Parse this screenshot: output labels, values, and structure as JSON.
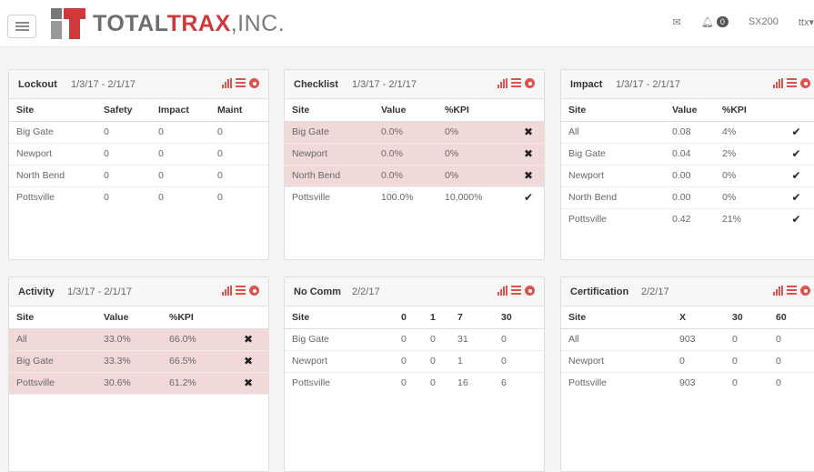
{
  "header": {
    "logo_main": "TOTAL",
    "logo_accent": "TRAX",
    "logo_inc": ",INC.",
    "notification_count": "0",
    "device": "SX200",
    "user": "ttx▾"
  },
  "colors": {
    "accent": "#d9534f",
    "bad_row": "#f1d9d9"
  },
  "panels": {
    "lockout": {
      "title": "Lockout",
      "range": "1/3/17 - 2/1/17",
      "headers": [
        "Site",
        "Safety",
        "Impact",
        "Maint"
      ],
      "rows": [
        [
          "Big Gate",
          "0",
          "0",
          "0"
        ],
        [
          "Newport",
          "0",
          "0",
          "0"
        ],
        [
          "North Bend",
          "0",
          "0",
          "0"
        ],
        [
          "Pottsville",
          "0",
          "0",
          "0"
        ]
      ]
    },
    "checklist": {
      "title": "Checklist",
      "range": "1/3/17 - 2/1/17",
      "headers": [
        "Site",
        "Value",
        "%KPI",
        ""
      ],
      "rows": [
        [
          "Big Gate",
          "0.0%",
          "0%",
          "✖"
        ],
        [
          "Newport",
          "0.0%",
          "0%",
          "✖"
        ],
        [
          "North Bend",
          "0.0%",
          "0%",
          "✖"
        ],
        [
          "Pottsville",
          "100.0%",
          "10,000%",
          "✔"
        ]
      ]
    },
    "impact": {
      "title": "Impact",
      "range": "1/3/17 - 2/1/17",
      "headers": [
        "Site",
        "Value",
        "%KPI",
        ""
      ],
      "rows": [
        [
          "All",
          "0.08",
          "4%",
          "✔"
        ],
        [
          "Big Gate",
          "0.04",
          "2%",
          "✔"
        ],
        [
          "Newport",
          "0.00",
          "0%",
          "✔"
        ],
        [
          "North Bend",
          "0.00",
          "0%",
          "✔"
        ],
        [
          "Pottsville",
          "0.42",
          "21%",
          "✔"
        ]
      ]
    },
    "activity": {
      "title": "Activity",
      "range": "1/3/17 - 2/1/17",
      "headers": [
        "Site",
        "Value",
        "%KPI",
        ""
      ],
      "rows": [
        [
          "All",
          "33.0%",
          "66.0%",
          "✖"
        ],
        [
          "Big Gate",
          "33.3%",
          "66.5%",
          "✖"
        ],
        [
          "Pottsville",
          "30.6%",
          "61.2%",
          "✖"
        ]
      ]
    },
    "nocomm": {
      "title": "No Comm",
      "range": "2/2/17",
      "headers": [
        "Site",
        "0",
        "1",
        "7",
        "30"
      ],
      "rows": [
        [
          "Big Gate",
          "0",
          "0",
          "31",
          "0"
        ],
        [
          "Newport",
          "0",
          "0",
          "1",
          "0"
        ],
        [
          "Pottsville",
          "0",
          "0",
          "16",
          "6"
        ]
      ]
    },
    "certification": {
      "title": "Certification",
      "range": "2/2/17",
      "headers": [
        "Site",
        "X",
        "30",
        "60"
      ],
      "rows": [
        [
          "All",
          "903",
          "0",
          "0"
        ],
        [
          "Newport",
          "0",
          "0",
          "0"
        ],
        [
          "Pottsville",
          "903",
          "0",
          "0"
        ]
      ]
    }
  }
}
